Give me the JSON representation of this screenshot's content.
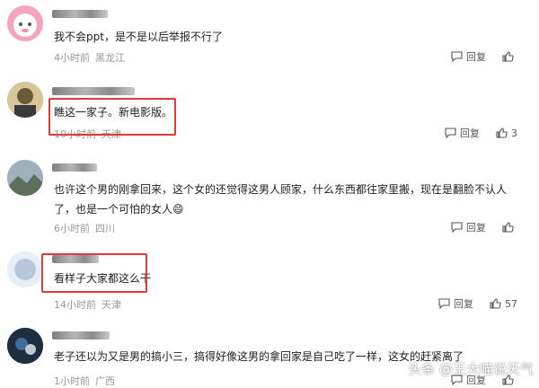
{
  "comments": [
    {
      "text": "我不会ppt，是不是以后举报不行了",
      "time": "4小时前",
      "location": "黑龙江",
      "reply_label": "回复",
      "likes": ""
    },
    {
      "text": "瞧这一家子。新电影版。",
      "time": "10小时前",
      "location": "天津",
      "reply_label": "回复",
      "likes": "3"
    },
    {
      "text": "也许这个男的刚拿回来，这个女的还觉得这男人顾家，什么东西都往家里搬，现在是翻脸不认人了，也是一个可怕的女人😄",
      "time": "6小时前",
      "location": "四川",
      "reply_label": "回复",
      "likes": ""
    },
    {
      "text": "看样子大家都这么干",
      "time": "14小时前",
      "location": "天津",
      "reply_label": "回复",
      "likes": "57"
    },
    {
      "text": "老子还以为又是男的搞小三，搞得好像这男的拿回家是自己吃了一样，这女的赶紧离了",
      "time": "1小时前",
      "location": "广西",
      "reply_label": "回复",
      "likes": ""
    }
  ],
  "watermark": "头条 @王大喵说天气",
  "colors": {
    "highlight_box": "#e23a3a",
    "meta_text": "#999999"
  }
}
